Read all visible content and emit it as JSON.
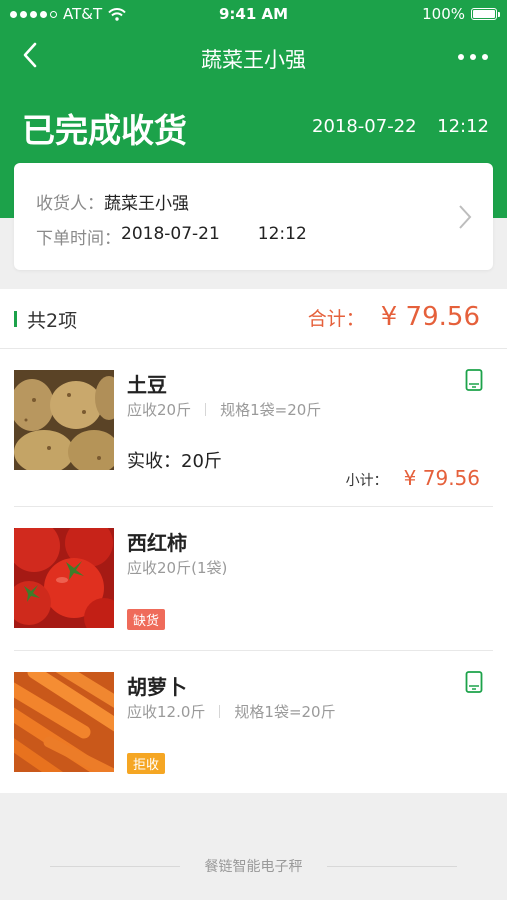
{
  "status_bar": {
    "carrier": "AT&T",
    "time": "9:41 AM",
    "battery": "100%"
  },
  "nav": {
    "title": "蔬菜王小强"
  },
  "header": {
    "status": "已完成收货",
    "date": "2018-07-22",
    "time": "12:12"
  },
  "info": {
    "receiver_label": "收货人：",
    "receiver": "蔬菜王小强",
    "order_time_label": "下单时间：",
    "order_date": "2018-07-21",
    "order_time": "12:12"
  },
  "summary": {
    "count": "共2项",
    "total_label": "合计：",
    "total": "¥ 79.56"
  },
  "items": [
    {
      "name": "土豆",
      "spec1": "应收20斤",
      "spec2": "规格1袋=20斤",
      "actual": "实收：20斤",
      "subtotal_label": "小计：",
      "subtotal": "¥ 79.56",
      "icon": "phone-icon"
    },
    {
      "name": "西红柿",
      "spec1": "应收20斤(1袋)",
      "badge": "缺货",
      "badge_color": "#ef6b5a"
    },
    {
      "name": "胡萝卜",
      "spec1": "应收12.0斤",
      "spec2": "规格1袋=20斤",
      "badge": "拒收",
      "badge_color": "#f5a623",
      "icon": "phone-icon"
    }
  ],
  "footer": {
    "text": "餐链智能电子秤"
  },
  "colors": {
    "brand": "#1ca24a",
    "price": "#e5603b"
  }
}
